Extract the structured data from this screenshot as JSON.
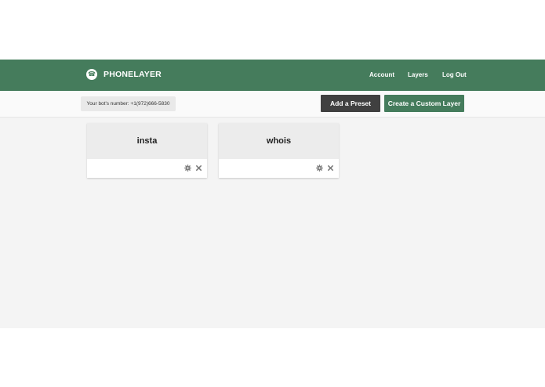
{
  "brand": {
    "name": "PHONELAYER",
    "logo_icon": "phone-logo-icon"
  },
  "nav": {
    "account": "Account",
    "layers": "Layers",
    "logout": "Log Out"
  },
  "toolbar": {
    "bot_number": "Your bot's number: +1(972)666-5830",
    "add_preset": "Add a Preset",
    "create_custom_layer": "Create a Custom Layer"
  },
  "layers": [
    {
      "name": "insta",
      "actions": [
        "gear-icon",
        "close-icon"
      ]
    },
    {
      "name": "whois",
      "actions": [
        "gear-icon",
        "close-icon"
      ]
    }
  ],
  "colors": {
    "brand_green": "#457c5c",
    "dark_button": "#404040",
    "page_background": "#f4f4f4",
    "card_header": "#ececec"
  }
}
